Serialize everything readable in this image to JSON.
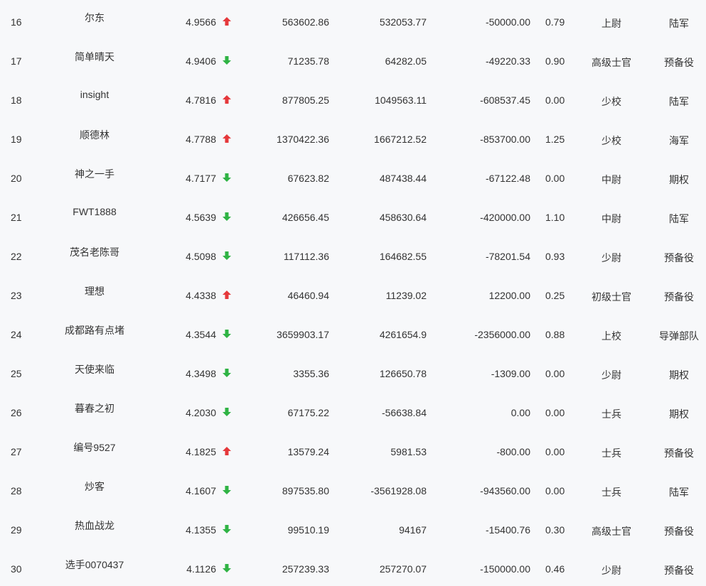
{
  "colors": {
    "up": "#e5383b",
    "down": "#2fb344",
    "background": "#f7f8fa",
    "text": "#333333"
  },
  "rows": [
    {
      "rank": "16",
      "name": "尔东",
      "score": "4.9566",
      "trend": "up",
      "trend_icon": "arrow-up-icon",
      "v1": "563602.86",
      "v2": "532053.77",
      "v3": "-50000.00",
      "ratio": "0.79",
      "rank_title": "上尉",
      "unit": "陆军"
    },
    {
      "rank": "17",
      "name": "简单晴天",
      "score": "4.9406",
      "trend": "down",
      "trend_icon": "arrow-down-icon",
      "v1": "71235.78",
      "v2": "64282.05",
      "v3": "-49220.33",
      "ratio": "0.90",
      "rank_title": "高级士官",
      "unit": "预备役"
    },
    {
      "rank": "18",
      "name": "insight",
      "score": "4.7816",
      "trend": "up",
      "trend_icon": "arrow-up-icon",
      "v1": "877805.25",
      "v2": "1049563.11",
      "v3": "-608537.45",
      "ratio": "0.00",
      "rank_title": "少校",
      "unit": "陆军"
    },
    {
      "rank": "19",
      "name": "顺德林",
      "score": "4.7788",
      "trend": "up",
      "trend_icon": "arrow-up-icon",
      "v1": "1370422.36",
      "v2": "1667212.52",
      "v3": "-853700.00",
      "ratio": "1.25",
      "rank_title": "少校",
      "unit": "海军"
    },
    {
      "rank": "20",
      "name": "神之一手",
      "score": "4.7177",
      "trend": "down",
      "trend_icon": "arrow-down-icon",
      "v1": "67623.82",
      "v2": "487438.44",
      "v3": "-67122.48",
      "ratio": "0.00",
      "rank_title": "中尉",
      "unit": "期权"
    },
    {
      "rank": "21",
      "name": "FWT1888",
      "score": "4.5639",
      "trend": "down",
      "trend_icon": "arrow-down-icon",
      "v1": "426656.45",
      "v2": "458630.64",
      "v3": "-420000.00",
      "ratio": "1.10",
      "rank_title": "中尉",
      "unit": "陆军"
    },
    {
      "rank": "22",
      "name": "茂名老陈哥",
      "score": "4.5098",
      "trend": "down",
      "trend_icon": "arrow-down-icon",
      "v1": "117112.36",
      "v2": "164682.55",
      "v3": "-78201.54",
      "ratio": "0.93",
      "rank_title": "少尉",
      "unit": "预备役"
    },
    {
      "rank": "23",
      "name": "理想",
      "score": "4.4338",
      "trend": "up",
      "trend_icon": "arrow-up-icon",
      "v1": "46460.94",
      "v2": "11239.02",
      "v3": "12200.00",
      "ratio": "0.25",
      "rank_title": "初级士官",
      "unit": "预备役"
    },
    {
      "rank": "24",
      "name": "成都路有点堵",
      "score": "4.3544",
      "trend": "down",
      "trend_icon": "arrow-down-icon",
      "v1": "3659903.17",
      "v2": "4261654.9",
      "v3": "-2356000.00",
      "ratio": "0.88",
      "rank_title": "上校",
      "unit": "导弹部队"
    },
    {
      "rank": "25",
      "name": "天使来临",
      "score": "4.3498",
      "trend": "down",
      "trend_icon": "arrow-down-icon",
      "v1": "3355.36",
      "v2": "126650.78",
      "v3": "-1309.00",
      "ratio": "0.00",
      "rank_title": "少尉",
      "unit": "期权"
    },
    {
      "rank": "26",
      "name": "暮春之初",
      "score": "4.2030",
      "trend": "down",
      "trend_icon": "arrow-down-icon",
      "v1": "67175.22",
      "v2": "-56638.84",
      "v3": "0.00",
      "ratio": "0.00",
      "rank_title": "士兵",
      "unit": "期权"
    },
    {
      "rank": "27",
      "name": "编号9527",
      "score": "4.1825",
      "trend": "up",
      "trend_icon": "arrow-up-icon",
      "v1": "13579.24",
      "v2": "5981.53",
      "v3": "-800.00",
      "ratio": "0.00",
      "rank_title": "士兵",
      "unit": "预备役"
    },
    {
      "rank": "28",
      "name": "炒客",
      "score": "4.1607",
      "trend": "down",
      "trend_icon": "arrow-down-icon",
      "v1": "897535.80",
      "v2": "-3561928.08",
      "v3": "-943560.00",
      "ratio": "0.00",
      "rank_title": "士兵",
      "unit": "陆军"
    },
    {
      "rank": "29",
      "name": "热血战龙",
      "score": "4.1355",
      "trend": "down",
      "trend_icon": "arrow-down-icon",
      "v1": "99510.19",
      "v2": "94167",
      "v3": "-15400.76",
      "ratio": "0.30",
      "rank_title": "高级士官",
      "unit": "预备役"
    },
    {
      "rank": "30",
      "name": "选手0070437",
      "score": "4.1126",
      "trend": "down",
      "trend_icon": "arrow-down-icon",
      "v1": "257239.33",
      "v2": "257270.07",
      "v3": "-150000.00",
      "ratio": "0.46",
      "rank_title": "少尉",
      "unit": "预备役"
    }
  ]
}
